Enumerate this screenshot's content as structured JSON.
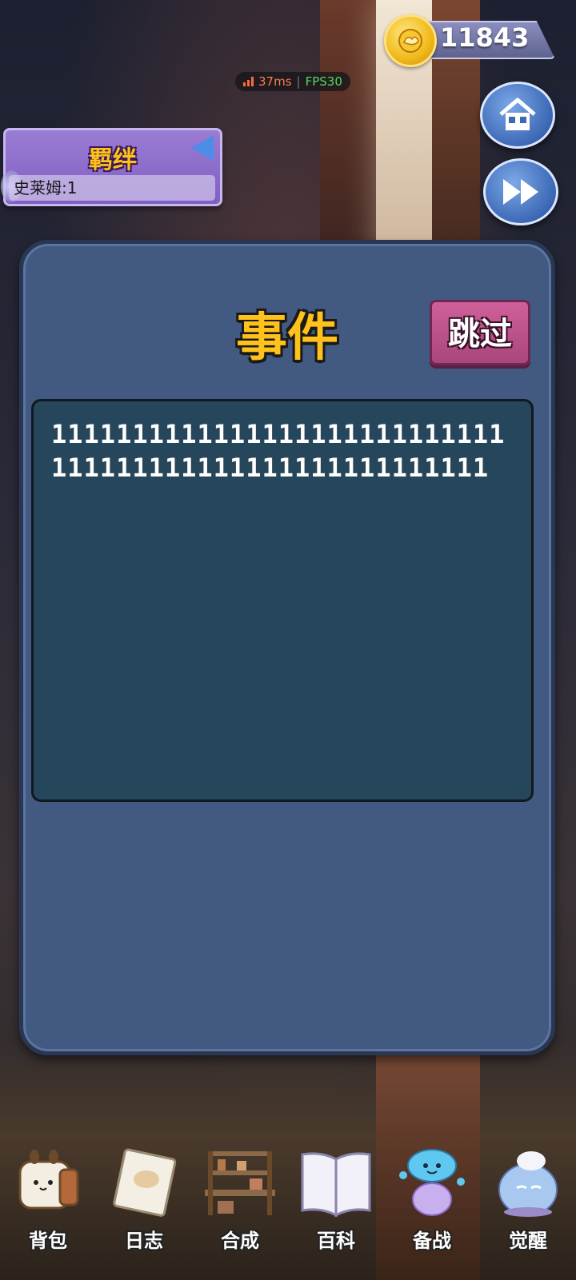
{
  "currency": {
    "icon": "gold-coin-icon",
    "value": "11843"
  },
  "network": {
    "ping": "37ms",
    "separator": "|",
    "fps": "FPS30"
  },
  "top_buttons": {
    "home": "home-icon",
    "fast_forward": "fast-forward-icon"
  },
  "bond_panel": {
    "title": "羁绊",
    "items": [
      {
        "label": "史莱姆:1"
      }
    ]
  },
  "event": {
    "title": "事件",
    "skip_label": "跳过",
    "text": "1111111111111111111111111111111111111111111111111111111"
  },
  "bottom_nav": [
    {
      "label": "背包",
      "icon": "backpack-icon"
    },
    {
      "label": "日志",
      "icon": "journal-icon"
    },
    {
      "label": "合成",
      "icon": "crafting-bench-icon"
    },
    {
      "label": "百科",
      "icon": "encyclopedia-book-icon"
    },
    {
      "label": "备战",
      "icon": "slime-mushroom-icon"
    },
    {
      "label": "觉醒",
      "icon": "awakened-slime-icon"
    }
  ]
}
